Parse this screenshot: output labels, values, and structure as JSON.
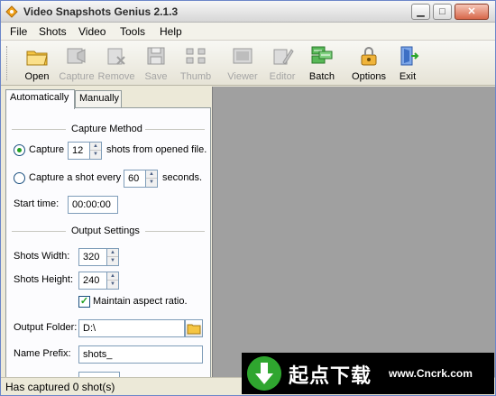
{
  "window": {
    "title": "Video Snapshots Genius 2.1.3"
  },
  "menu": [
    {
      "label": "File"
    },
    {
      "label": "Shots"
    },
    {
      "label": "Video"
    },
    {
      "label": "Tools"
    },
    {
      "label": "Help"
    }
  ],
  "toolbar": [
    {
      "label": "Open",
      "icon": "open-folder-icon",
      "enabled": true
    },
    {
      "label": "Capture",
      "icon": "capture-icon",
      "enabled": false
    },
    {
      "label": "Remove",
      "icon": "remove-icon",
      "enabled": false
    },
    {
      "label": "Save",
      "icon": "save-icon",
      "enabled": false
    },
    {
      "label": "Thumb",
      "icon": "thumb-icon",
      "enabled": false
    },
    {
      "label": "Viewer",
      "icon": "viewer-icon",
      "enabled": false
    },
    {
      "label": "Editor",
      "icon": "editor-icon",
      "enabled": false
    },
    {
      "label": "Batch",
      "icon": "batch-icon",
      "enabled": true
    },
    {
      "label": "Options",
      "icon": "options-icon",
      "enabled": true
    },
    {
      "label": "Exit",
      "icon": "exit-icon",
      "enabled": true
    }
  ],
  "tabs": [
    {
      "label": "Automatically",
      "active": true
    },
    {
      "label": "Manually",
      "active": false
    }
  ],
  "capture_method": {
    "title": "Capture Method",
    "option1_label": "Capture",
    "option1_value": "12",
    "option1_suffix": "shots from opened file.",
    "option1_selected": true,
    "option2_label": "Capture a shot every",
    "option2_value": "60",
    "option2_suffix": "seconds.",
    "option2_selected": false,
    "start_time_label": "Start time:",
    "start_time_value": "00:00:00"
  },
  "output_settings": {
    "title": "Output Settings",
    "width_label": "Shots Width:",
    "width_value": "320",
    "height_label": "Shots Height:",
    "height_value": "240",
    "aspect_label": "Maintain aspect ratio.",
    "aspect_checked": true,
    "folder_label": "Output Folder:",
    "folder_value": "D:\\",
    "prefix_label": "Name Prefix:",
    "prefix_value": "shots_"
  },
  "status": {
    "text": "Has captured 0 shot(s)"
  },
  "watermark": {
    "cn_text": "起点下载",
    "url": "www.Cncrk.com"
  },
  "colors": {
    "preview_bg": "#a0a0a0",
    "accent_green": "#21a121",
    "window_bg": "#ece9d8"
  }
}
